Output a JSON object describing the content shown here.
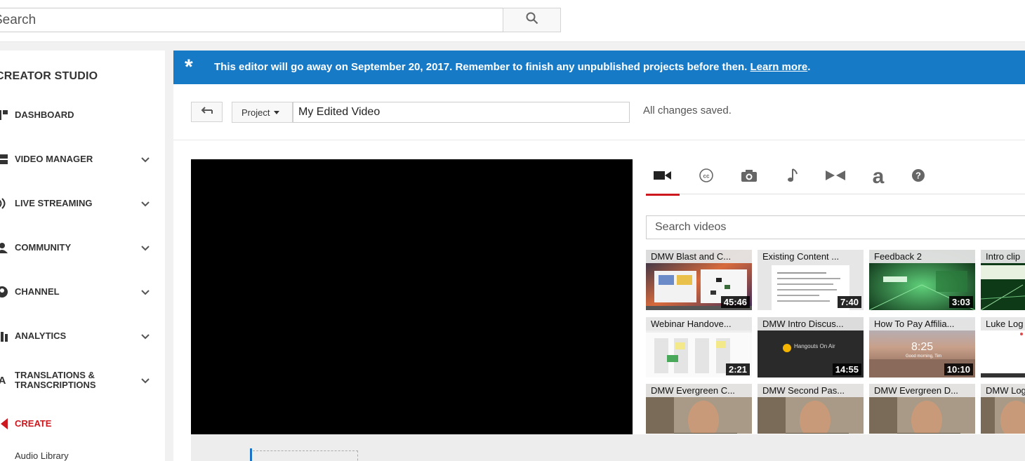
{
  "search": {
    "placeholder": "Search"
  },
  "sidebar": {
    "title": "CREATOR STUDIO",
    "items": [
      {
        "label": "DASHBOARD",
        "icon": "dashboard-icon",
        "has_chevron": false
      },
      {
        "label": "VIDEO MANAGER",
        "icon": "video-manager-icon",
        "has_chevron": true
      },
      {
        "label": "LIVE STREAMING",
        "icon": "live-streaming-icon",
        "has_chevron": true
      },
      {
        "label": "COMMUNITY",
        "icon": "community-icon",
        "has_chevron": true
      },
      {
        "label": "CHANNEL",
        "icon": "channel-icon",
        "has_chevron": true
      },
      {
        "label": "ANALYTICS",
        "icon": "analytics-icon",
        "has_chevron": true
      },
      {
        "label_line1": "TRANSLATIONS &",
        "label_line2": "TRANSCRIPTIONS",
        "icon": "translations-icon",
        "has_chevron": true
      },
      {
        "label": "CREATE",
        "icon": "create-icon",
        "has_chevron": false,
        "active": true
      }
    ],
    "sub_items": [
      {
        "label": "Audio Library"
      }
    ]
  },
  "banner": {
    "text": "This editor will go away on September 20, 2017. Remember to finish any unpublished projects before then.",
    "link": "Learn more",
    "suffix": ".",
    "color": "#167ac6"
  },
  "project": {
    "dropdown_label": "Project",
    "title_value": "My Edited Video",
    "status": "All changes saved."
  },
  "tools": {
    "tabs": [
      {
        "icon": "video-camera-icon",
        "active": true
      },
      {
        "icon": "captions-icon",
        "active": false
      },
      {
        "icon": "photo-camera-icon",
        "active": false
      },
      {
        "icon": "music-note-icon",
        "active": false
      },
      {
        "icon": "transitions-icon",
        "active": false
      },
      {
        "icon": "text-icon",
        "active": false
      },
      {
        "icon": "help-icon",
        "active": false
      }
    ],
    "search_placeholder": "Search videos",
    "videos": [
      {
        "title": "DMW Blast and C...",
        "duration": "45:46",
        "style": "desktop"
      },
      {
        "title": "Existing Content ...",
        "duration": "7:40",
        "style": "document"
      },
      {
        "title": "Feedback 2",
        "duration": "3:03",
        "style": "green"
      },
      {
        "title": "Intro clip",
        "duration": "",
        "style": "intro"
      },
      {
        "title": "Webinar Handove...",
        "duration": "2:21",
        "style": "sheet"
      },
      {
        "title": "DMW Intro Discus...",
        "duration": "14:55",
        "style": "hangouts",
        "overlay_text": "Hangouts On Air"
      },
      {
        "title": "How To Pay Affilia...",
        "duration": "10:10",
        "style": "landscape",
        "overlay_text": "8:25",
        "overlay_sub": "Good morning, Tim"
      },
      {
        "title": "Luke Log",
        "duration": "",
        "style": "blank"
      },
      {
        "title": "DMW Evergreen C...",
        "duration": "",
        "style": "person"
      },
      {
        "title": "DMW Second Pas...",
        "duration": "",
        "style": "person"
      },
      {
        "title": "DMW Evergreen D...",
        "duration": "",
        "style": "person"
      },
      {
        "title": "DMW Log",
        "duration": "",
        "style": "person"
      }
    ]
  },
  "colors": {
    "accent_red": "#cc181e",
    "timeline_cursor": "#1a73c8"
  }
}
